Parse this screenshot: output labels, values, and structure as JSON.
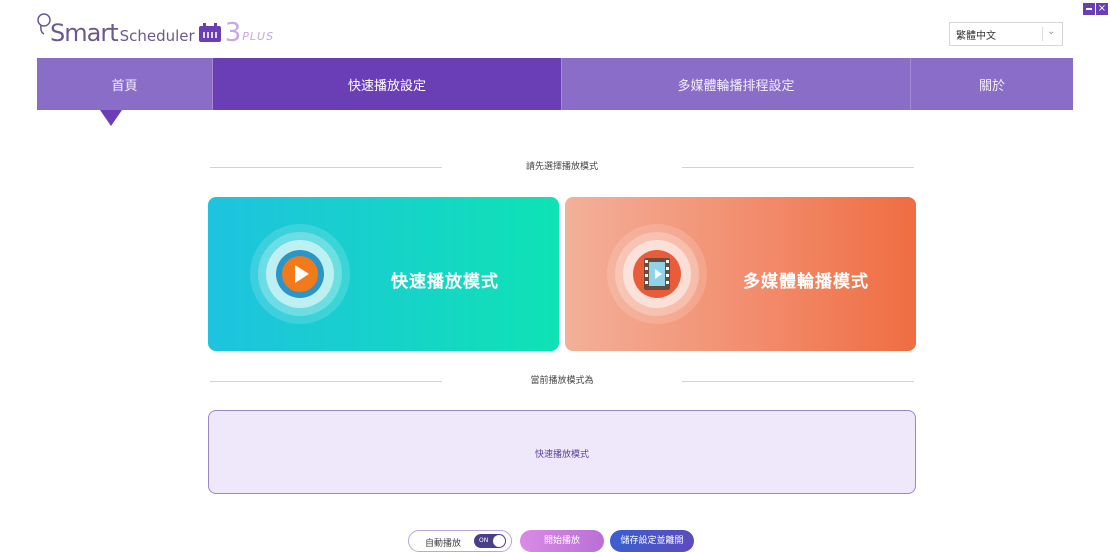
{
  "header": {
    "logo": {
      "smart": "Smart",
      "scheduler": "Scheduler",
      "version": "3",
      "edition": "PLUS"
    },
    "language_select": {
      "value": "繁體中文"
    },
    "window_controls": {
      "minimize_icon": "minimize-icon",
      "close_icon": "close-icon",
      "close_glyph": "×"
    }
  },
  "nav": {
    "tabs": [
      {
        "label": "首頁",
        "active": false
      },
      {
        "label": "快速播放設定",
        "active": true
      },
      {
        "label": "多媒體輪播排程設定",
        "active": false
      },
      {
        "label": "關於",
        "active": false
      }
    ]
  },
  "main": {
    "select_mode_heading": "請先選擇播放模式",
    "modes": [
      {
        "label": "快速播放模式",
        "icon": "play-icon",
        "color": "#1ec3df"
      },
      {
        "label": "多媒體輪播模式",
        "icon": "film-icon",
        "color": "#ef6d42"
      }
    ],
    "current_mode_heading": "當前播放模式為",
    "current_mode_value": "快速播放模式"
  },
  "footer": {
    "auto_play_label": "自動播放",
    "toggle_text": "ON",
    "start_button": "開始播放",
    "save_button": "儲存設定並離開"
  },
  "colors": {
    "accent": "#6a3fb5",
    "nav": "#8a6dc7",
    "current_box_bg": "#efe8fb"
  }
}
